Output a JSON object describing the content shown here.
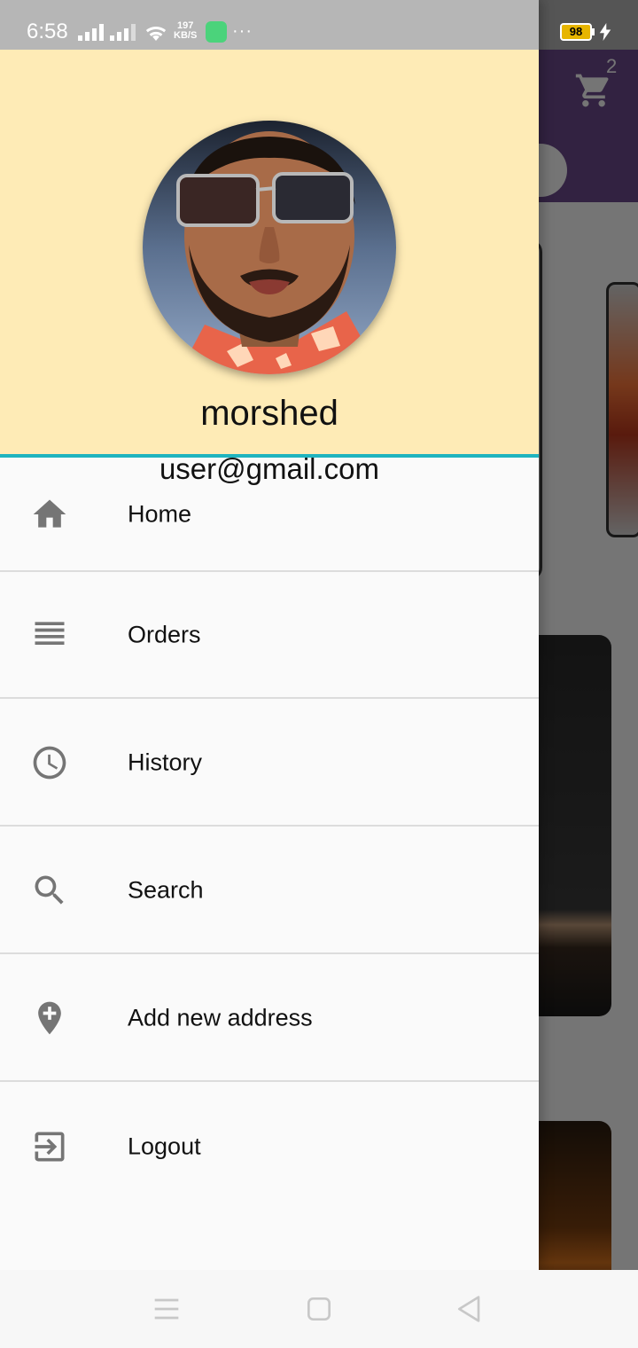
{
  "status_bar": {
    "time": "6:58",
    "net_speed_value": "197",
    "net_speed_unit": "KB/S",
    "battery_level": "98",
    "more_dots": "···"
  },
  "background_app": {
    "cart_count": "2",
    "accent_color": "#6e4a8f"
  },
  "drawer": {
    "header": {
      "name": "morshed",
      "email": "user@gmail.com",
      "background_color": "#feebb6",
      "divider_color": "#1fb4bf"
    },
    "menu": [
      {
        "label": "Home",
        "icon": "home-icon"
      },
      {
        "label": "Orders",
        "icon": "list-icon"
      },
      {
        "label": "History",
        "icon": "clock-icon"
      },
      {
        "label": "Search",
        "icon": "search-icon"
      },
      {
        "label": "Add new address",
        "icon": "add-location-icon"
      },
      {
        "label": "Logout",
        "icon": "logout-icon"
      }
    ]
  },
  "nav_bar": {
    "buttons": [
      "menu-icon",
      "home-square-icon",
      "back-triangle-icon"
    ]
  }
}
